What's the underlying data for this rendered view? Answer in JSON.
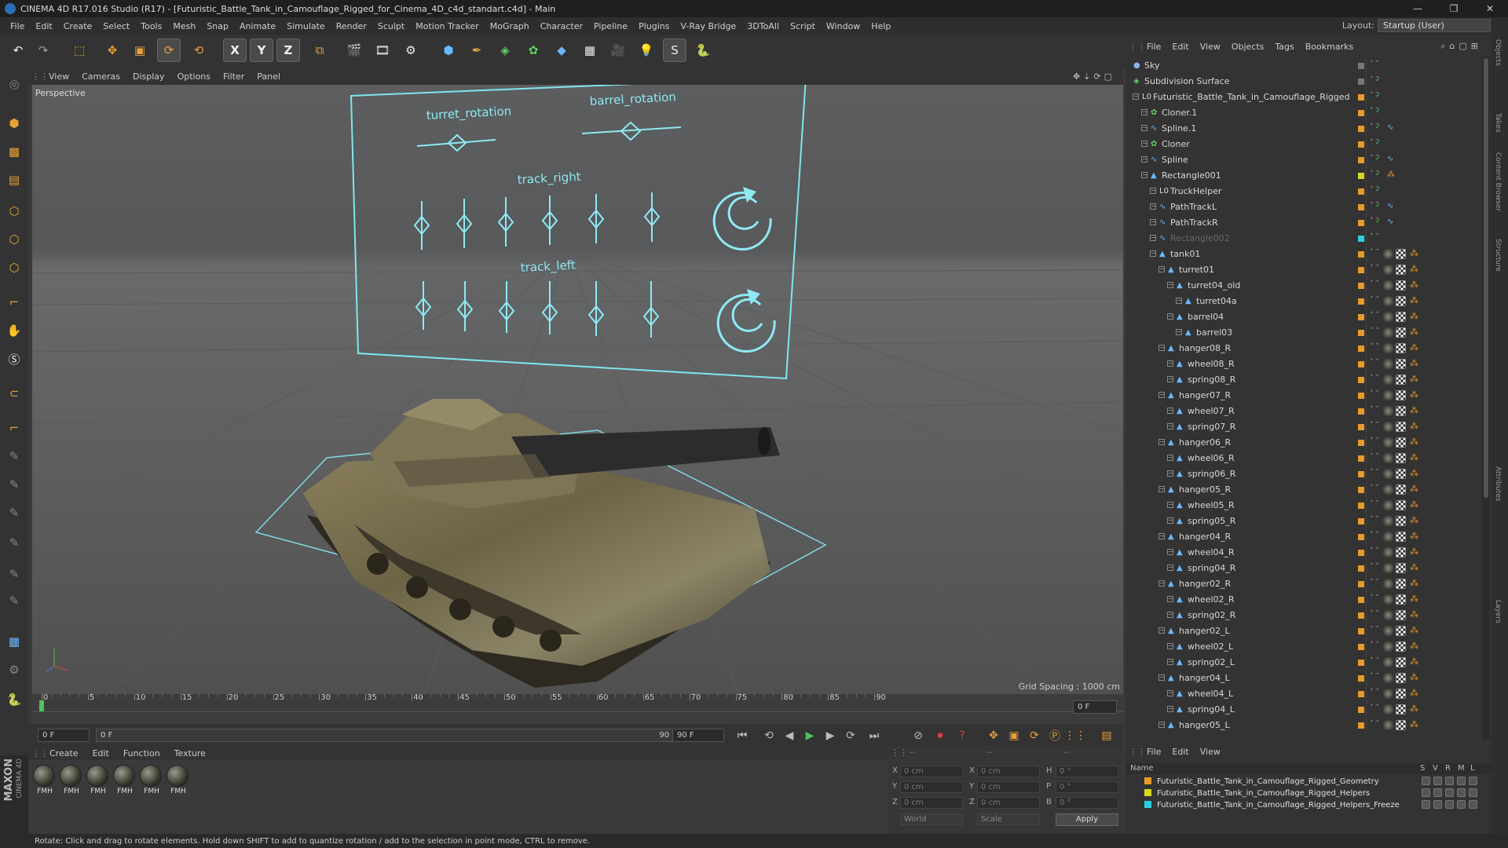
{
  "window": {
    "title": "CINEMA 4D R17.016 Studio (R17) - [Futuristic_Battle_Tank_in_Camouflage_Rigged_for_Cinema_4D_c4d_standart.c4d] - Main",
    "controls": [
      "—",
      "❐",
      "✕"
    ]
  },
  "menubar": {
    "items": [
      "File",
      "Edit",
      "Create",
      "Select",
      "Tools",
      "Mesh",
      "Snap",
      "Animate",
      "Simulate",
      "Render",
      "Sculpt",
      "Motion Tracker",
      "MoGraph",
      "Character",
      "Pipeline",
      "Plugins",
      "V-Ray Bridge",
      "3DToAll",
      "Script",
      "Window",
      "Help"
    ],
    "layout_label": "Layout:",
    "layout_value": "Startup (User)"
  },
  "toolbar": {
    "icons": [
      "undo-icon",
      "redo-icon",
      "live-select-icon",
      "move-icon",
      "scale-icon",
      "rotate-icon",
      "recent-tool-icon",
      "x-axis-icon",
      "y-axis-icon",
      "z-axis-icon",
      "world-coordinates-icon",
      "render-view-icon",
      "render-picture-viewer-icon",
      "edit-render-settings-icon",
      "cube-icon",
      "pen-spline-icon",
      "subdivision-icon",
      "cloner-icon",
      "deformer-icon",
      "floor-icon",
      "camera-icon",
      "light-icon",
      "script-icon",
      "python-icon"
    ],
    "axis_labels": [
      "X",
      "Y",
      "Z"
    ]
  },
  "viewport": {
    "menu": [
      "View",
      "Cameras",
      "Display",
      "Options",
      "Filter",
      "Panel"
    ],
    "label": "Perspective",
    "grid_spacing": "Grid Spacing : 1000 cm",
    "controls": {
      "turret_rotation": "turret_rotation",
      "barrel_rotation": "barrel_rotation",
      "track_right": "track_right",
      "track_left": "track_left"
    }
  },
  "timeline": {
    "ticks": [
      "0",
      "5",
      "10",
      "15",
      "20",
      "25",
      "30",
      "35",
      "40",
      "45",
      "50",
      "55",
      "60",
      "65",
      "70",
      "75",
      "80",
      "85",
      "90"
    ],
    "current_frame": "0 F",
    "start_field": "0 F",
    "range_start": "0 F",
    "range_end": "90 F",
    "end_field": "90 F"
  },
  "materials": {
    "menu": [
      "Create",
      "Edit",
      "Function",
      "Texture"
    ],
    "items": [
      "FMH",
      "FMH",
      "FMH",
      "FMH",
      "FMH",
      "FMH"
    ]
  },
  "coordinates": {
    "rows": [
      {
        "a": "X",
        "av": "0 cm",
        "b": "X",
        "bv": "0 cm",
        "c": "H",
        "cv": "0 °"
      },
      {
        "a": "Y",
        "av": "0 cm",
        "b": "Y",
        "bv": "0 cm",
        "c": "P",
        "cv": "0 °"
      },
      {
        "a": "Z",
        "av": "0 cm",
        "b": "Z",
        "bv": "0 cm",
        "c": "B",
        "cv": "0 °"
      }
    ],
    "mode1": "World",
    "mode2": "Scale",
    "apply": "Apply",
    "header_marks": [
      "--",
      "--",
      "--"
    ]
  },
  "object_manager": {
    "menu": [
      "File",
      "Edit",
      "View",
      "Objects",
      "Tags",
      "Bookmarks"
    ],
    "objects": [
      {
        "name": "Sky",
        "depth": 0,
        "icon": "sky",
        "color": "#777"
      },
      {
        "name": "Subdivision Surface",
        "depth": 0,
        "icon": "subdiv",
        "color": "#777"
      },
      {
        "name": "Futuristic_Battle_Tank_in_Camouflage_Rigged",
        "depth": 1,
        "icon": "null",
        "color": "#e89a2a"
      },
      {
        "name": "Cloner.1",
        "depth": 2,
        "icon": "cloner",
        "color": "#e89a2a"
      },
      {
        "name": "Spline.1",
        "depth": 2,
        "icon": "spline",
        "color": "#e89a2a"
      },
      {
        "name": "Cloner",
        "depth": 2,
        "icon": "cloner",
        "color": "#e89a2a"
      },
      {
        "name": "Spline",
        "depth": 2,
        "icon": "spline",
        "color": "#e89a2a"
      },
      {
        "name": "Rectangle001",
        "depth": 2,
        "icon": "poly",
        "color": "#d8d820"
      },
      {
        "name": "TruckHelper",
        "depth": 3,
        "icon": "null",
        "color": "#e89a2a"
      },
      {
        "name": "PathTrackL",
        "depth": 3,
        "icon": "spline",
        "color": "#e89a2a"
      },
      {
        "name": "PathTrackR",
        "depth": 3,
        "icon": "spline",
        "color": "#e89a2a"
      },
      {
        "name": "Rectangle002",
        "depth": 3,
        "icon": "spline",
        "color": "#2ad0e0",
        "dim": true
      },
      {
        "name": "tank01",
        "depth": 3,
        "icon": "poly",
        "color": "#e89a2a"
      },
      {
        "name": "turret01",
        "depth": 4,
        "icon": "poly",
        "color": "#e89a2a"
      },
      {
        "name": "turret04_old",
        "depth": 5,
        "icon": "poly",
        "color": "#e89a2a"
      },
      {
        "name": "turret04a",
        "depth": 6,
        "icon": "poly",
        "color": "#e89a2a"
      },
      {
        "name": "barrel04",
        "depth": 5,
        "icon": "poly",
        "color": "#e89a2a"
      },
      {
        "name": "barrel03",
        "depth": 6,
        "icon": "poly",
        "color": "#e89a2a"
      },
      {
        "name": "hanger08_R",
        "depth": 4,
        "icon": "poly",
        "color": "#e89a2a"
      },
      {
        "name": "wheel08_R",
        "depth": 5,
        "icon": "poly",
        "color": "#e89a2a"
      },
      {
        "name": "spring08_R",
        "depth": 5,
        "icon": "poly",
        "color": "#e89a2a"
      },
      {
        "name": "hanger07_R",
        "depth": 4,
        "icon": "poly",
        "color": "#e89a2a"
      },
      {
        "name": "wheel07_R",
        "depth": 5,
        "icon": "poly",
        "color": "#e89a2a"
      },
      {
        "name": "spring07_R",
        "depth": 5,
        "icon": "poly",
        "color": "#e89a2a"
      },
      {
        "name": "hanger06_R",
        "depth": 4,
        "icon": "poly",
        "color": "#e89a2a"
      },
      {
        "name": "wheel06_R",
        "depth": 5,
        "icon": "poly",
        "color": "#e89a2a"
      },
      {
        "name": "spring06_R",
        "depth": 5,
        "icon": "poly",
        "color": "#e89a2a"
      },
      {
        "name": "hanger05_R",
        "depth": 4,
        "icon": "poly",
        "color": "#e89a2a"
      },
      {
        "name": "wheel05_R",
        "depth": 5,
        "icon": "poly",
        "color": "#e89a2a"
      },
      {
        "name": "spring05_R",
        "depth": 5,
        "icon": "poly",
        "color": "#e89a2a"
      },
      {
        "name": "hanger04_R",
        "depth": 4,
        "icon": "poly",
        "color": "#e89a2a"
      },
      {
        "name": "wheel04_R",
        "depth": 5,
        "icon": "poly",
        "color": "#e89a2a"
      },
      {
        "name": "spring04_R",
        "depth": 5,
        "icon": "poly",
        "color": "#e89a2a"
      },
      {
        "name": "hanger02_R",
        "depth": 4,
        "icon": "poly",
        "color": "#e89a2a"
      },
      {
        "name": "wheel02_R",
        "depth": 5,
        "icon": "poly",
        "color": "#e89a2a"
      },
      {
        "name": "spring02_R",
        "depth": 5,
        "icon": "poly",
        "color": "#e89a2a"
      },
      {
        "name": "hanger02_L",
        "depth": 4,
        "icon": "poly",
        "color": "#e89a2a"
      },
      {
        "name": "wheel02_L",
        "depth": 5,
        "icon": "poly",
        "color": "#e89a2a"
      },
      {
        "name": "spring02_L",
        "depth": 5,
        "icon": "poly",
        "color": "#e89a2a"
      },
      {
        "name": "hanger04_L",
        "depth": 4,
        "icon": "poly",
        "color": "#e89a2a"
      },
      {
        "name": "wheel04_L",
        "depth": 5,
        "icon": "poly",
        "color": "#e89a2a"
      },
      {
        "name": "spring04_L",
        "depth": 5,
        "icon": "poly",
        "color": "#e89a2a"
      },
      {
        "name": "hanger05_L",
        "depth": 4,
        "icon": "poly",
        "color": "#e89a2a"
      }
    ]
  },
  "layer_manager": {
    "menu": [
      "File",
      "Edit",
      "View"
    ],
    "header": {
      "name": "Name",
      "cols": [
        "S",
        "V",
        "R",
        "M",
        "L"
      ]
    },
    "layers": [
      {
        "name": "Futuristic_Battle_Tank_in_Camouflage_Rigged_Geometry",
        "color": "#e89a2a"
      },
      {
        "name": "Futuristic_Battle_Tank_in_Camouflage_Rigged_Helpers",
        "color": "#d8d820"
      },
      {
        "name": "Futuristic_Battle_Tank_in_Camouflage_Rigged_Helpers_Freeze",
        "color": "#2ad0e0"
      }
    ]
  },
  "right_tabs": [
    "Objects",
    "Takes",
    "Content Browser",
    "Structure",
    "Attributes",
    "Layers"
  ],
  "maxon_logo": [
    "MAXON",
    "CINEMA 4D"
  ],
  "status": "Rotate: Click and drag to rotate elements. Hold down SHIFT to add to quantize rotation / add to the selection in point mode, CTRL to remove."
}
